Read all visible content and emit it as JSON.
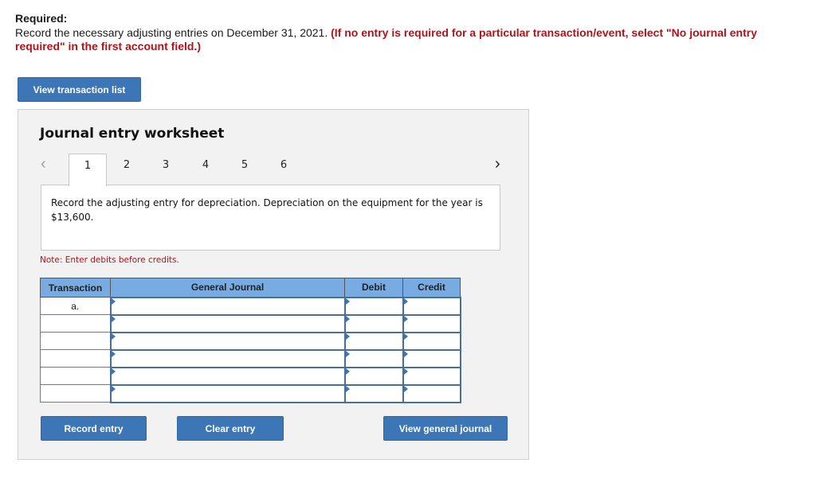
{
  "header": {
    "required_label": "Required:",
    "instruction_text": "Record the necessary adjusting entries on December 31, 2021. ",
    "instruction_note": "(If no entry is required for a particular transaction/event, select \"No journal entry required\" in the first account field.)"
  },
  "buttons": {
    "view_transaction_list": "View transaction list",
    "record_entry": "Record entry",
    "clear_entry": "Clear entry",
    "view_general_journal": "View general journal"
  },
  "worksheet": {
    "title": "Journal entry worksheet",
    "nav_prev_icon": "‹",
    "nav_next_icon": "›",
    "tabs": [
      {
        "label": "1",
        "active": true
      },
      {
        "label": "2",
        "active": false
      },
      {
        "label": "3",
        "active": false
      },
      {
        "label": "4",
        "active": false
      },
      {
        "label": "5",
        "active": false
      },
      {
        "label": "6",
        "active": false
      }
    ],
    "prompt": "Record the adjusting entry for depreciation. Depreciation on the equipment for the year is $13,600.",
    "note": "Note: Enter debits before credits."
  },
  "table": {
    "headers": {
      "transaction": "Transaction",
      "general_journal": "General Journal",
      "debit": "Debit",
      "credit": "Credit"
    },
    "rows": [
      {
        "transaction": "a.",
        "account": "",
        "debit": "",
        "credit": ""
      },
      {
        "transaction": "",
        "account": "",
        "debit": "",
        "credit": ""
      },
      {
        "transaction": "",
        "account": "",
        "debit": "",
        "credit": ""
      },
      {
        "transaction": "",
        "account": "",
        "debit": "",
        "credit": ""
      },
      {
        "transaction": "",
        "account": "",
        "debit": "",
        "credit": ""
      },
      {
        "transaction": "",
        "account": "",
        "debit": "",
        "credit": ""
      }
    ]
  },
  "colors": {
    "button_blue": "#3d76b7",
    "header_blue": "#77abe2",
    "note_red": "#b3121a"
  }
}
